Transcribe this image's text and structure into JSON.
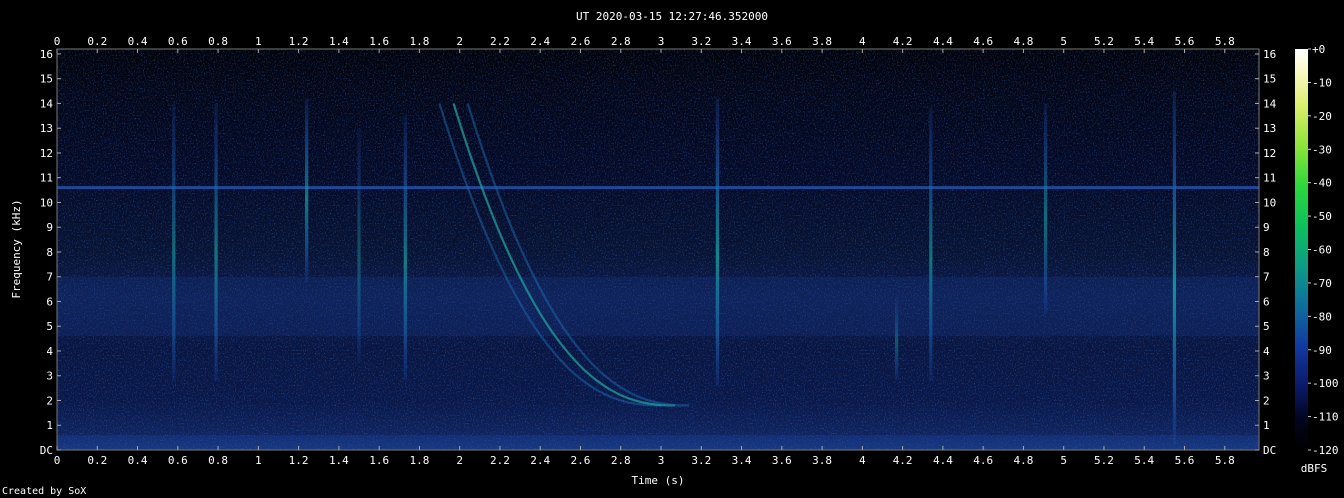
{
  "chart_data": {
    "type": "heatmap",
    "title": "UT 2020-03-15 12:27:46.352000",
    "xlabel": "Time (s)",
    "ylabel": "Frequency (kHz)",
    "xlim": [
      0,
      5.97
    ],
    "ylim": [
      0,
      16.2
    ],
    "x_ticks": [
      "0",
      "0.2",
      "0.4",
      "0.6",
      "0.8",
      "1",
      "1.2",
      "1.4",
      "1.6",
      "1.8",
      "2",
      "2.2",
      "2.4",
      "2.6",
      "2.8",
      "3",
      "3.2",
      "3.4",
      "3.6",
      "3.8",
      "4",
      "4.2",
      "4.4",
      "4.6",
      "4.8",
      "5",
      "5.2",
      "5.4",
      "5.6",
      "5.8"
    ],
    "y_ticks": [
      "DC",
      "1",
      "2",
      "3",
      "4",
      "5",
      "6",
      "7",
      "8",
      "9",
      "10",
      "11",
      "12",
      "13",
      "14",
      "15",
      "16"
    ],
    "colorbar": {
      "label": "dBFS",
      "ticks": [
        "+0",
        "-10",
        "-20",
        "-30",
        "-40",
        "-50",
        "-60",
        "-70",
        "-80",
        "-90",
        "-100",
        "-110",
        "-120"
      ],
      "range": [
        -120,
        0
      ]
    },
    "features": {
      "horizontal_tone_khz": 10.6,
      "background_noise_band_khz": [
        4.6,
        7.0
      ],
      "impulses": [
        {
          "time_s": 0.58,
          "freq_khz": [
            2.8,
            14.0
          ],
          "level_dbfs": -85
        },
        {
          "time_s": 0.79,
          "freq_khz": [
            2.8,
            14.0
          ],
          "level_dbfs": -82
        },
        {
          "time_s": 1.24,
          "freq_khz": [
            6.8,
            14.2
          ],
          "level_dbfs": -80
        },
        {
          "time_s": 1.5,
          "freq_khz": [
            3.5,
            13.0
          ],
          "level_dbfs": -95
        },
        {
          "time_s": 1.73,
          "freq_khz": [
            2.8,
            13.5
          ],
          "level_dbfs": -80
        },
        {
          "time_s": 3.28,
          "freq_khz": [
            2.6,
            14.2
          ],
          "level_dbfs": -75
        },
        {
          "time_s": 4.17,
          "freq_khz": [
            2.8,
            6.2
          ],
          "level_dbfs": -95
        },
        {
          "time_s": 4.34,
          "freq_khz": [
            2.8,
            13.8
          ],
          "level_dbfs": -82
        },
        {
          "time_s": 4.91,
          "freq_khz": [
            5.5,
            14.0
          ],
          "level_dbfs": -85
        },
        {
          "time_s": 5.55,
          "freq_khz": [
            0.2,
            14.5
          ],
          "level_dbfs": -72
        }
      ],
      "whistler": {
        "start_time_s": 1.9,
        "start_freq_khz": 14.0,
        "end_time_s": 3.0,
        "end_freq_khz": 1.8,
        "level_dbfs": -80
      }
    }
  },
  "footer": {
    "credit": "Created by SoX"
  }
}
